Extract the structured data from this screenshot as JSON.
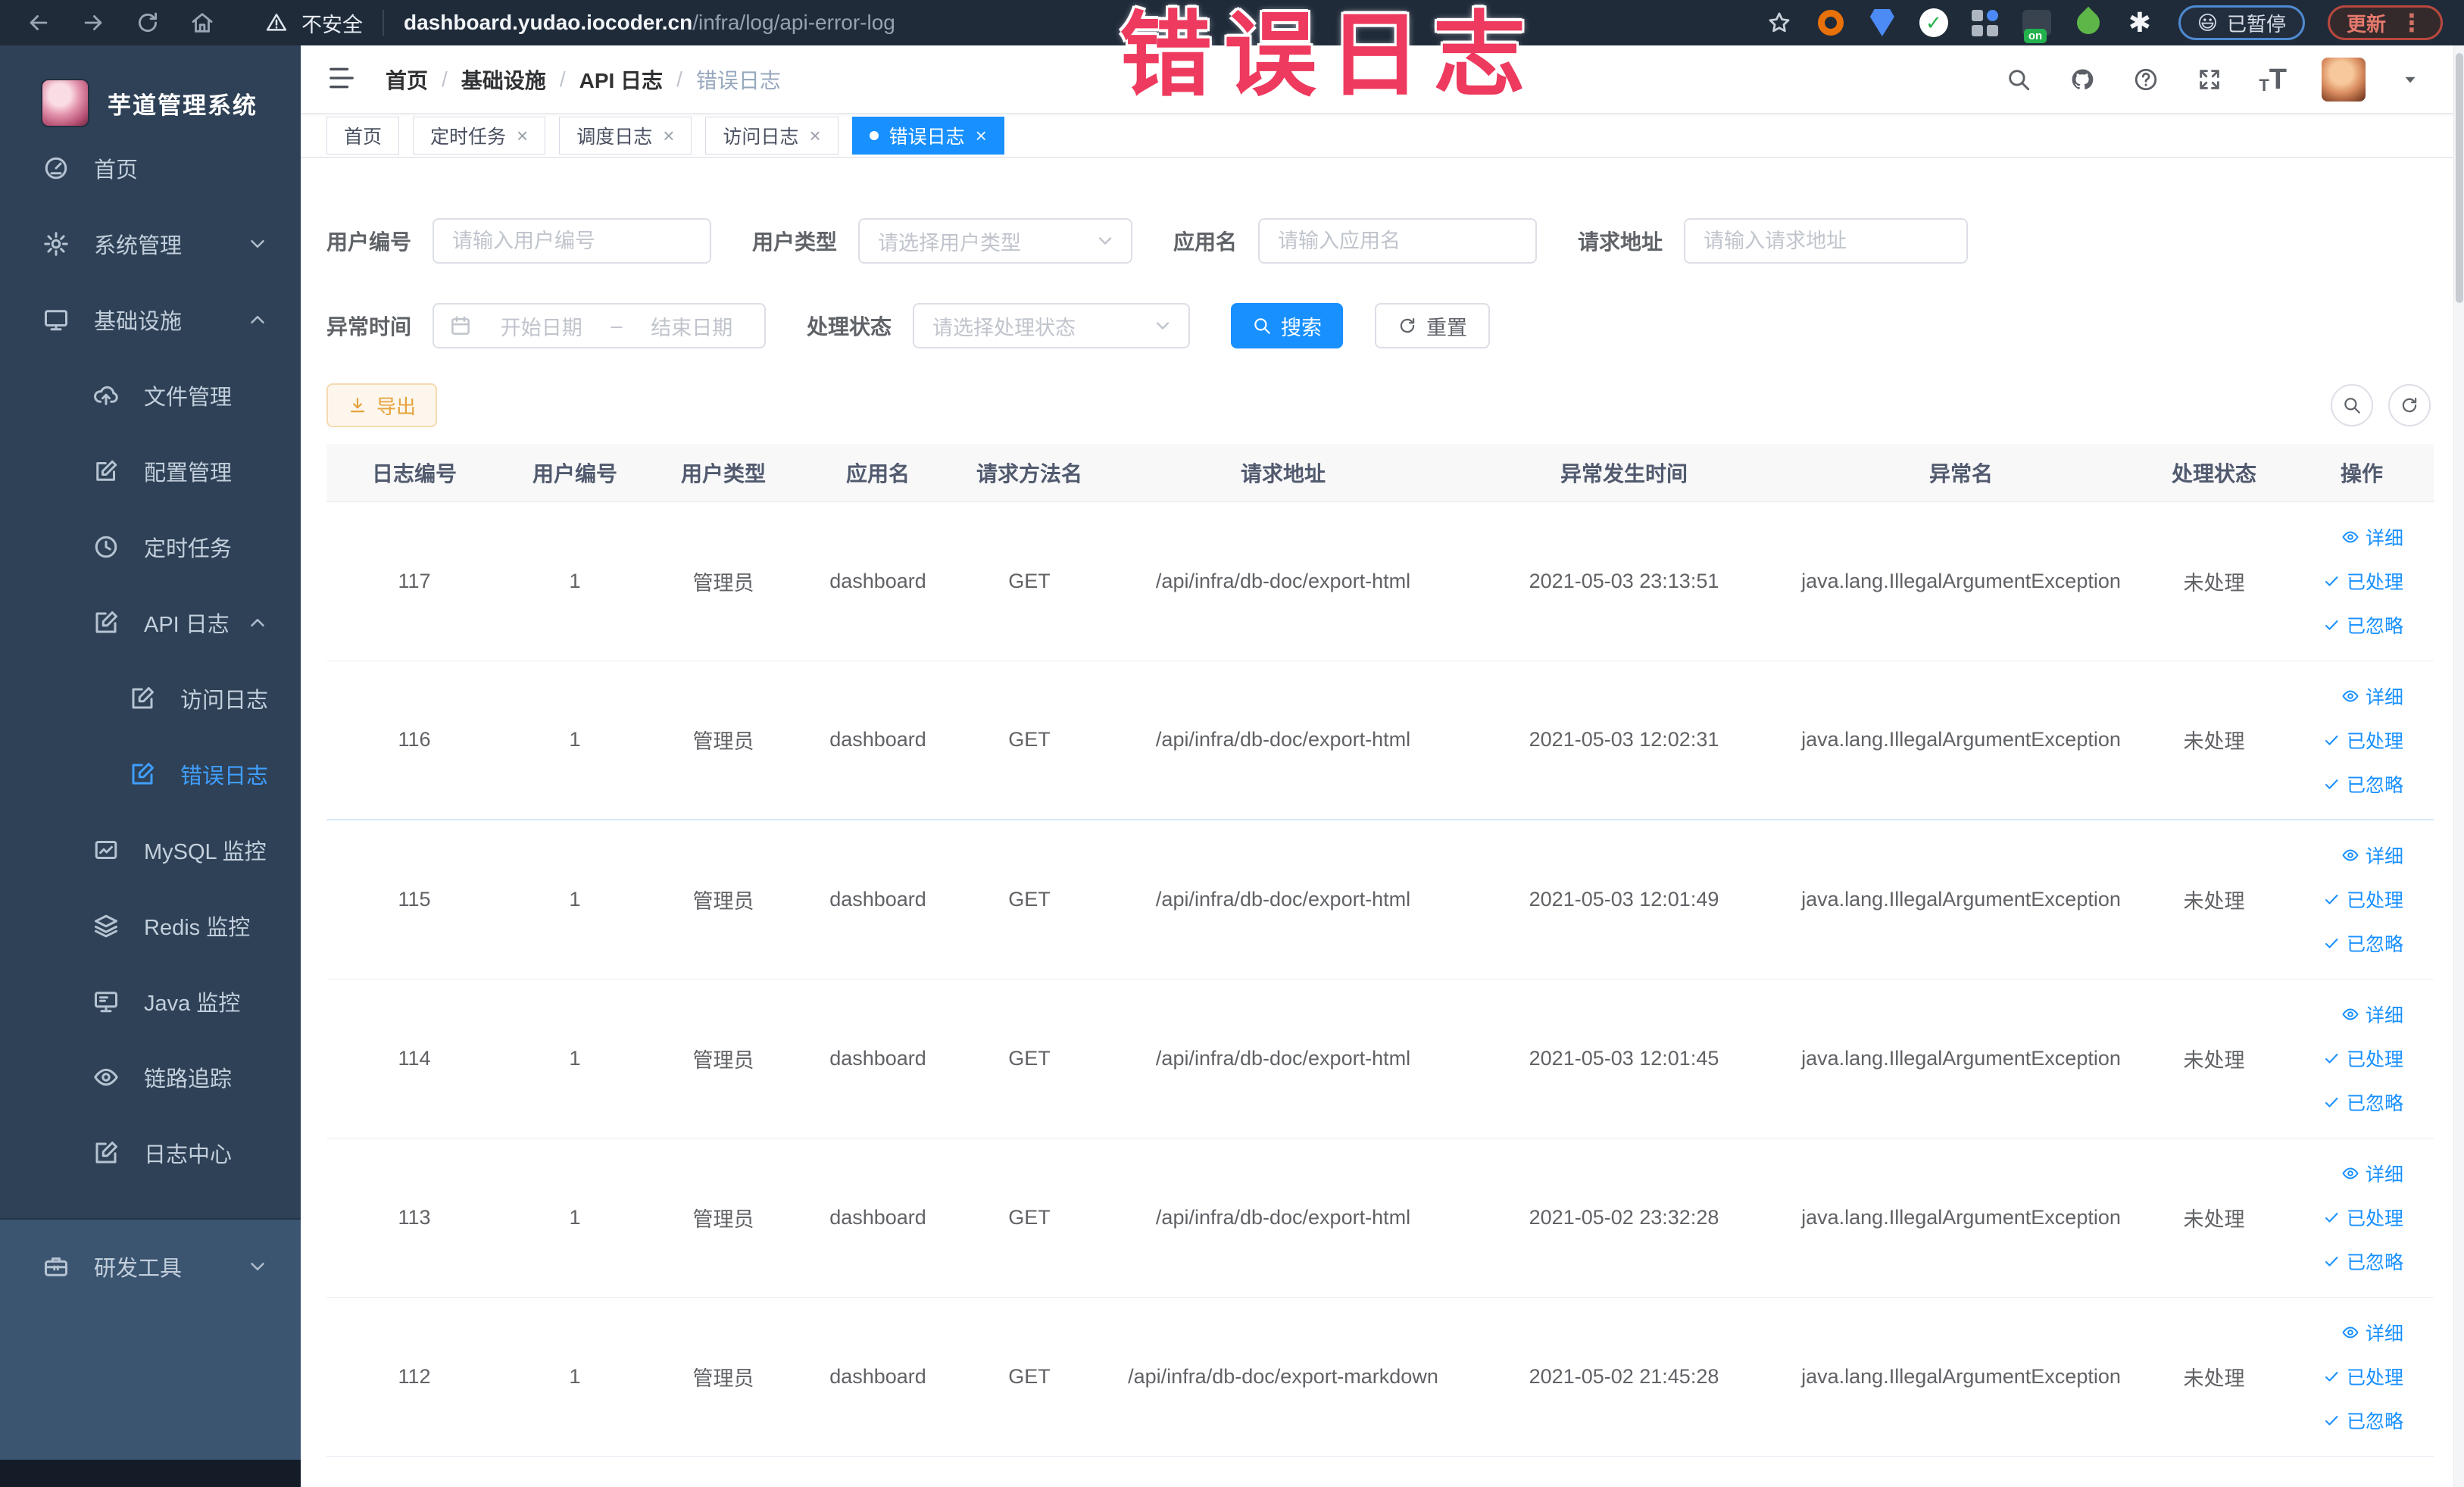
{
  "colors": {
    "primary": "#1890ff",
    "sidebar_active": "#409eff",
    "export": "#e6a23c",
    "overlay": "#ee3a5e"
  },
  "overlay": {
    "title": "错误日志"
  },
  "browser": {
    "security_label": "不安全",
    "url_domain": "dashboard.yudao.iocoder.cn",
    "url_path": "/infra/log/api-error-log",
    "paused_badge": {
      "emoji": "😃",
      "label": "已暂停"
    },
    "update_button": "更新",
    "extensions": [
      {
        "key": "orange-circle"
      },
      {
        "key": "blue-shield"
      },
      {
        "key": "green-check",
        "glyph": "✓"
      },
      {
        "key": "grid"
      },
      {
        "key": "dark-on",
        "badge": "on"
      },
      {
        "key": "green-leaf"
      },
      {
        "key": "white-puzzle",
        "glyph": "✱"
      }
    ]
  },
  "sidebar": {
    "app_title": "芋道管理系统",
    "items": [
      {
        "key": "home",
        "label": "首页",
        "icon": "gauge",
        "level": 1
      },
      {
        "key": "system-management",
        "label": "系统管理",
        "icon": "gear",
        "level": 1,
        "chevron": "down"
      },
      {
        "key": "infrastructure",
        "label": "基础设施",
        "icon": "monitor",
        "level": 1,
        "chevron": "up"
      },
      {
        "key": "file-management",
        "label": "文件管理",
        "icon": "cloud-upload",
        "level": 2
      },
      {
        "key": "config-management",
        "label": "配置管理",
        "icon": "edit",
        "level": 2
      },
      {
        "key": "scheduled-task",
        "label": "定时任务",
        "icon": "clock",
        "level": 2
      },
      {
        "key": "api-log",
        "label": "API 日志",
        "icon": "doc-edit",
        "level": 2,
        "chevron": "up"
      },
      {
        "key": "access-log",
        "label": "访问日志",
        "icon": "doc-edit",
        "level": 3
      },
      {
        "key": "error-log",
        "label": "错误日志",
        "icon": "doc-edit",
        "level": 3,
        "active": true
      },
      {
        "key": "mysql-monitor",
        "label": "MySQL 监控",
        "icon": "database",
        "level": 2
      },
      {
        "key": "redis-monitor",
        "label": "Redis 监控",
        "icon": "layers",
        "level": 2
      },
      {
        "key": "java-monitor",
        "label": "Java 监控",
        "icon": "java-monitor",
        "level": 2
      },
      {
        "key": "trace",
        "label": "链路追踪",
        "icon": "eye",
        "level": 2
      },
      {
        "key": "log-center",
        "label": "日志中心",
        "icon": "doc-edit",
        "level": 2
      },
      {
        "key": "dev-tools",
        "label": "研发工具",
        "icon": "toolbox",
        "level": 1,
        "chevron": "down",
        "section": "dev"
      }
    ]
  },
  "header": {
    "breadcrumb": [
      "首页",
      "基础设施",
      "API 日志",
      "错误日志"
    ]
  },
  "tabs": [
    {
      "key": "home",
      "label": "首页",
      "closable": false,
      "active": false
    },
    {
      "key": "scheduled-task",
      "label": "定时任务",
      "closable": true,
      "active": false
    },
    {
      "key": "schedule-log",
      "label": "调度日志",
      "closable": true,
      "active": false
    },
    {
      "key": "access-log",
      "label": "访问日志",
      "closable": true,
      "active": false
    },
    {
      "key": "error-log",
      "label": "错误日志",
      "closable": true,
      "active": true
    }
  ],
  "filters": {
    "user_id": {
      "label": "用户编号",
      "placeholder": "请输入用户编号"
    },
    "user_type": {
      "label": "用户类型",
      "placeholder": "请选择用户类型"
    },
    "app_name": {
      "label": "应用名",
      "placeholder": "请输入应用名"
    },
    "request_url": {
      "label": "请求地址",
      "placeholder": "请输入请求地址"
    },
    "exception_time": {
      "label": "异常时间",
      "start_placeholder": "开始日期",
      "separator": "–",
      "end_placeholder": "结束日期"
    },
    "process_status": {
      "label": "处理状态",
      "placeholder": "请选择处理状态"
    },
    "search_button": "搜索",
    "reset_button": "重置"
  },
  "toolbar": {
    "export_button": "导出"
  },
  "table": {
    "columns": [
      "日志编号",
      "用户编号",
      "用户类型",
      "应用名",
      "请求方法名",
      "请求地址",
      "异常发生时间",
      "异常名",
      "处理状态",
      "操作"
    ],
    "actions": [
      {
        "key": "detail",
        "label": "详细",
        "icon": "eye"
      },
      {
        "key": "processed",
        "label": "已处理",
        "icon": "check"
      },
      {
        "key": "ignored",
        "label": "已忽略",
        "icon": "check"
      }
    ],
    "rows": [
      {
        "id": "117",
        "user_id": "1",
        "user_type": "管理员",
        "app": "dashboard",
        "method": "GET",
        "url": "/api/infra/db-doc/export-html",
        "time": "2021-05-03 23:13:51",
        "exception": "java.lang.IllegalArgumentException",
        "status": "未处理"
      },
      {
        "id": "116",
        "user_id": "1",
        "user_type": "管理员",
        "app": "dashboard",
        "method": "GET",
        "url": "/api/infra/db-doc/export-html",
        "time": "2021-05-03 12:02:31",
        "exception": "java.lang.IllegalArgumentException",
        "status": "未处理"
      },
      {
        "id": "115",
        "user_id": "1",
        "user_type": "管理员",
        "app": "dashboard",
        "method": "GET",
        "url": "/api/infra/db-doc/export-html",
        "time": "2021-05-03 12:01:49",
        "exception": "java.lang.IllegalArgumentException",
        "status": "未处理"
      },
      {
        "id": "114",
        "user_id": "1",
        "user_type": "管理员",
        "app": "dashboard",
        "method": "GET",
        "url": "/api/infra/db-doc/export-html",
        "time": "2021-05-03 12:01:45",
        "exception": "java.lang.IllegalArgumentException",
        "status": "未处理"
      },
      {
        "id": "113",
        "user_id": "1",
        "user_type": "管理员",
        "app": "dashboard",
        "method": "GET",
        "url": "/api/infra/db-doc/export-html",
        "time": "2021-05-02 23:32:28",
        "exception": "java.lang.IllegalArgumentException",
        "status": "未处理"
      },
      {
        "id": "112",
        "user_id": "1",
        "user_type": "管理员",
        "app": "dashboard",
        "method": "GET",
        "url": "/api/infra/db-doc/export-markdown",
        "time": "2021-05-02 21:45:28",
        "exception": "java.lang.IllegalArgumentException",
        "status": "未处理"
      }
    ]
  }
}
